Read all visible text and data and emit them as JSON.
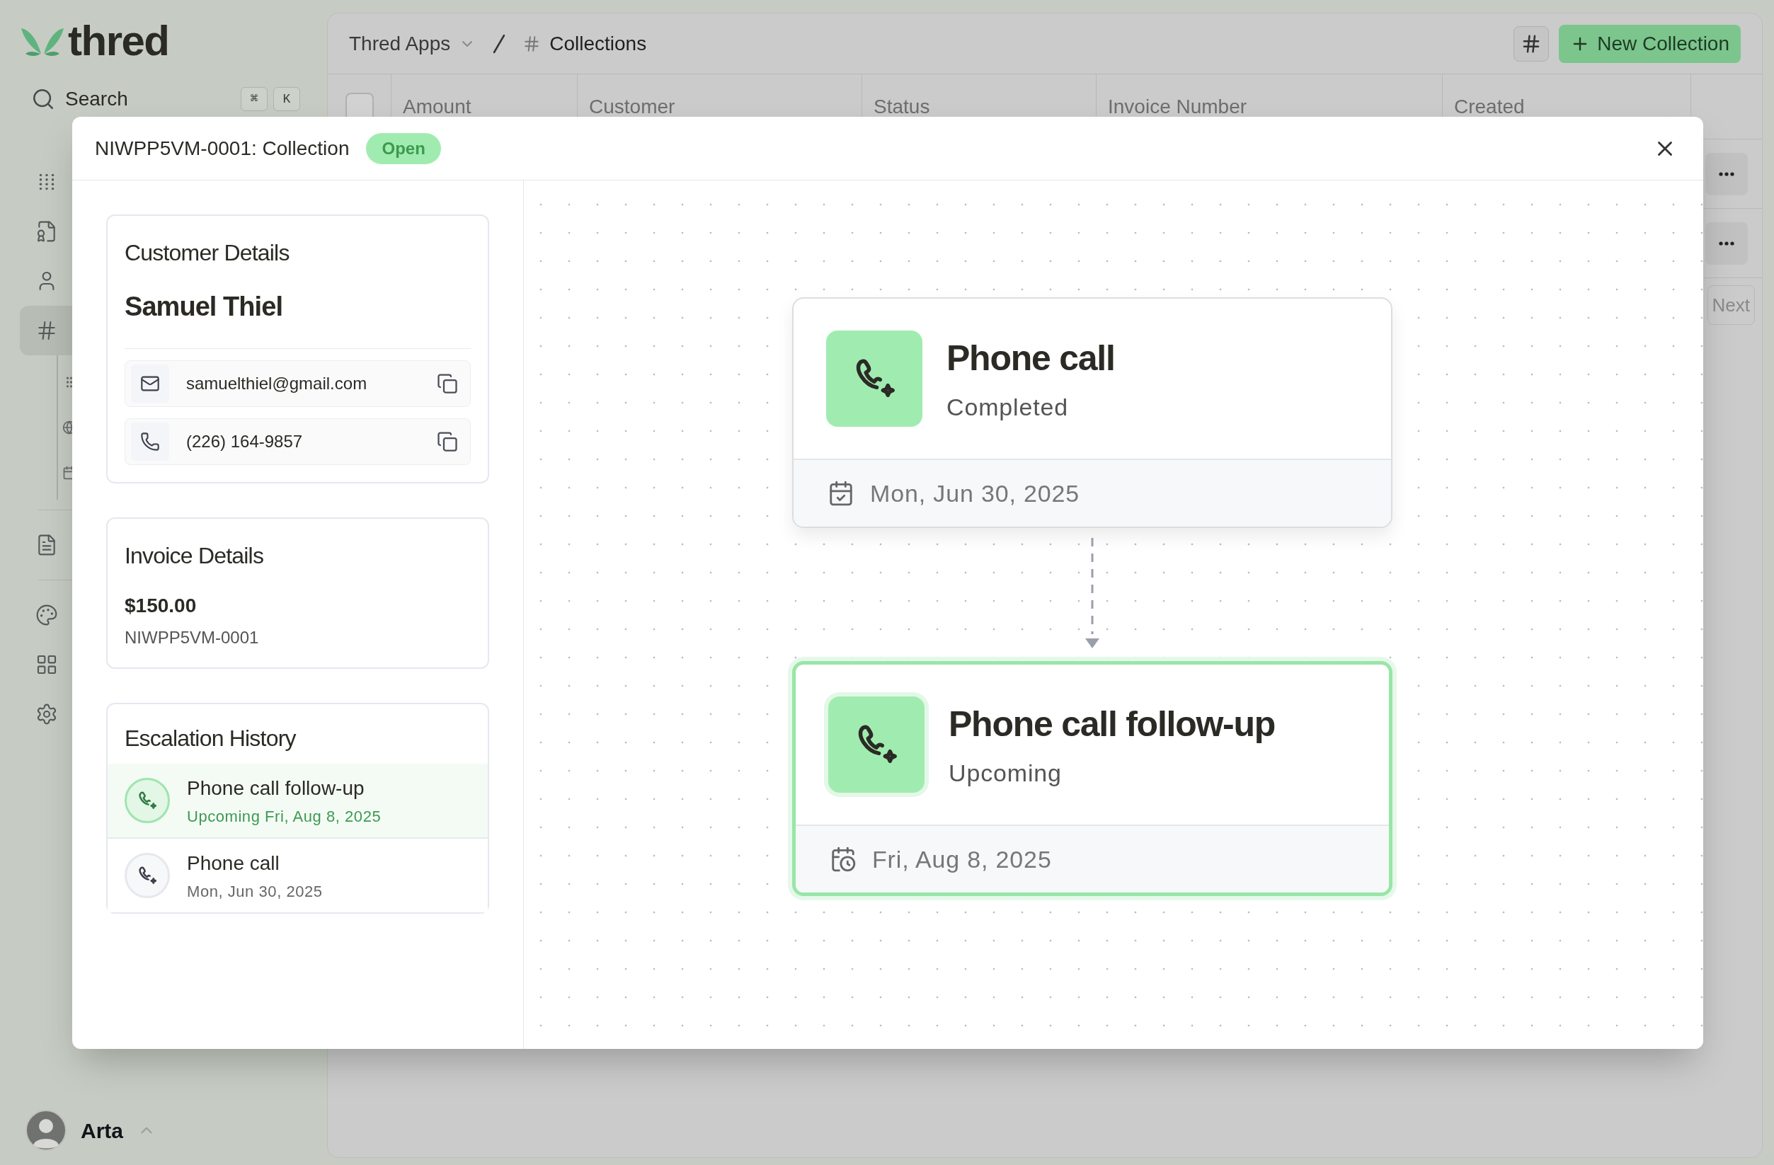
{
  "brand": {
    "name": "thred"
  },
  "sidebar": {
    "search": {
      "label": "Search",
      "shortcut": [
        "⌘",
        "K"
      ]
    },
    "nav": [
      {
        "selected": false
      },
      {
        "selected": false
      },
      {
        "selected": false
      },
      {
        "selected": true
      },
      {
        "selected": false
      },
      {
        "selected": false
      },
      {
        "selected": false
      },
      {
        "selected": false
      }
    ],
    "user": {
      "name": "Arta"
    }
  },
  "breadcrumb": [
    {
      "label": "Thred Apps"
    },
    {
      "label": "Collections"
    }
  ],
  "new_button": {
    "label": "New Collection"
  },
  "table": {
    "select_all": {
      "checked": false
    },
    "columns": [
      "Amount",
      "Customer",
      "Status",
      "Invoice Number",
      "Created"
    ]
  },
  "pagination": {
    "next": "Next"
  },
  "modal": {
    "title": "NIWPP5VM-0001: Collection",
    "status": "Open",
    "customer": {
      "heading": "Customer Details",
      "name": "Samuel Thiel",
      "contacts": [
        {
          "kind": "email",
          "value": "samuelthiel@gmail.com"
        },
        {
          "kind": "phone",
          "value": "(226) 164-9857"
        }
      ]
    },
    "invoice": {
      "heading": "Invoice Details",
      "amount": "$150.00",
      "number": "NIWPP5VM-0001"
    },
    "escalations": {
      "heading": "Escalation History",
      "items": [
        {
          "title": "Phone call follow-up",
          "subtitle": "Upcoming Fri, Aug 8, 2025",
          "selected": true
        },
        {
          "title": "Phone call",
          "subtitle": "Mon, Jun 30, 2025",
          "selected": false
        }
      ]
    },
    "flow": {
      "nodes": [
        {
          "kind": "completed",
          "title": "Phone call",
          "status": "Completed",
          "date": "Mon, Jun 30, 2025",
          "selected": false
        },
        {
          "kind": "upcoming",
          "title": "Phone call follow-up",
          "status": "Upcoming",
          "date": "Fri, Aug 8, 2025",
          "selected": true
        }
      ]
    }
  }
}
